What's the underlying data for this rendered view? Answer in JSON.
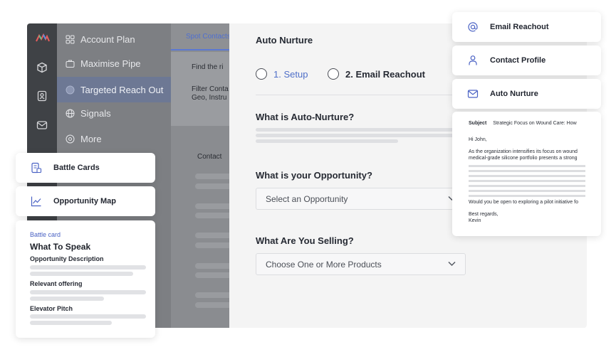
{
  "sidebar": {
    "items": [
      {
        "label": "Account Plan",
        "icon": "grid-icon"
      },
      {
        "label": "Maximise Pipe",
        "icon": "briefcase-icon"
      },
      {
        "label": "Targeted Reach Out",
        "icon": "target-icon",
        "active": true
      },
      {
        "label": "Signals",
        "icon": "globe-icon"
      },
      {
        "label": "More",
        "icon": "more-icon"
      }
    ]
  },
  "middle": {
    "tab": "Spot Contacts",
    "find_text": "Find the ri",
    "filter_line1": "Filter Conta",
    "filter_line2": "Geo, Instru",
    "contact_label": "Contact"
  },
  "main": {
    "title": "Auto Nurture",
    "step1": "1. Setup",
    "step2": "2. Email Reachout",
    "q1": "What is Auto-Nurture?",
    "q2": "What is your Opportunity?",
    "opportunity_placeholder": "Select an Opportunity",
    "q3": "What Are You Selling?",
    "products_placeholder": "Choose One or More Products"
  },
  "cards": {
    "battle_cards": "Battle Cards",
    "opportunity_map": "Opportunity Map",
    "email_reachout": "Email Reachout",
    "contact_profile": "Contact Profile",
    "auto_nurture": "Auto Nurture"
  },
  "battle_card": {
    "label": "Battle card",
    "heading": "What To Speak",
    "sections": [
      "Opportunity Description",
      "Relevant offering",
      "Elevator Pitch"
    ]
  },
  "email": {
    "subject_label": "Subject",
    "subject": "Strategic Focus on Wound Care: How",
    "greeting": "Hi John,",
    "line1": "As the organization intensifies its focus on wound",
    "line2": "medical-grade silicone portfolio presents a strong",
    "closing_line": "Would you be open to exploring a pilot initiative fo",
    "signoff": "Best regards,",
    "name": "Kevin"
  },
  "colors": {
    "accent": "#4f6fc8",
    "rail": "#3f4246",
    "sidebar": "#7d7f83"
  }
}
